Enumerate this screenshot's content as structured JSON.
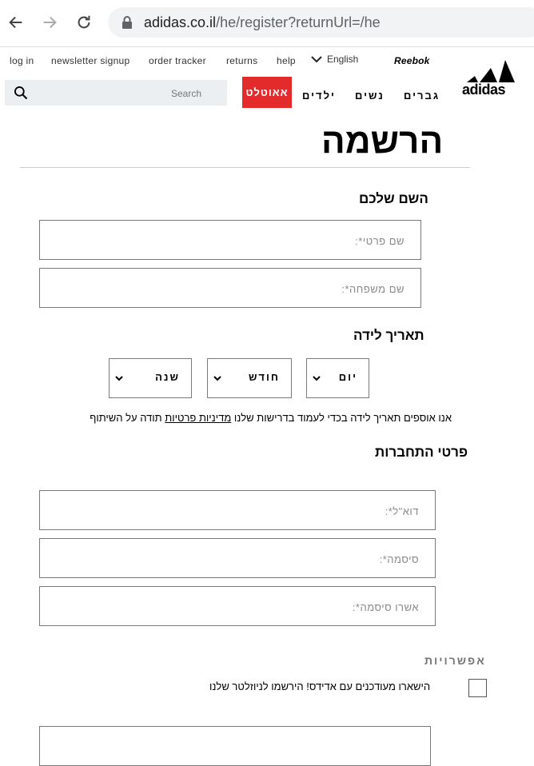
{
  "browser": {
    "url_host": "adidas.co.il",
    "url_path": "/he/register?returnUrl=/he"
  },
  "header": {
    "utility_links": [
      "log in",
      "newsletter signup",
      "order tracker",
      "returns",
      "help"
    ],
    "language": "English",
    "reebok": "Reebok",
    "logo_text": "adidas",
    "search_placeholder": "Search",
    "outlet": "אאוטלט",
    "categories": [
      "גברים",
      "נשים",
      "ילדים"
    ]
  },
  "form": {
    "title": "הרשמה",
    "name_section": "השם שלכם",
    "first_name_placeholder": "שם פרטי*:",
    "last_name_placeholder": "שם משפחה*:",
    "dob_section": "תאריך לידה",
    "day": "יום",
    "month": "חודש",
    "year": "שנה",
    "dob_note_pre": "אנו אוספים תאריך לידה בכדי לעמוד בדרישות שלנו ",
    "dob_note_link": "מדיניות פרטיות",
    "dob_note_post": " תודה על השיתוף",
    "login_section": "פרטי התחברות",
    "email_placeholder": "דוא\"ל*:",
    "password_placeholder": "סיסמה*:",
    "confirm_placeholder": "אשרו סיסמה*:",
    "options_section": "אפשרויות",
    "newsletter_label": "הישארו מעודכנים עם אדידס! הירשמו לניוזלטר שלנו"
  }
}
